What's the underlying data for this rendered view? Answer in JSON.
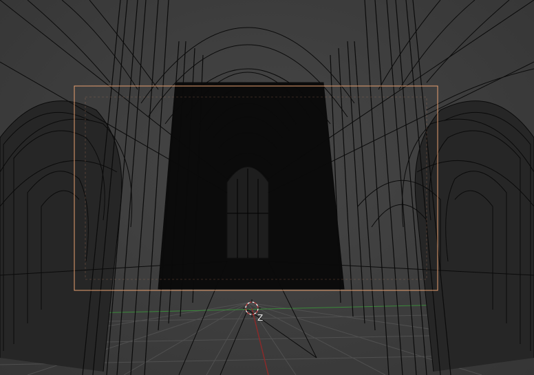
{
  "viewport": {
    "mode": "wireframe",
    "scene": "gothic-cathedral-nave",
    "background_color": "#3d3d3d",
    "wire_color": "#0a0a0a",
    "camera_frame_color": "#e8a070",
    "grid_color": "#5a5a5a",
    "x_axis_color": "#3a8a3a",
    "y_axis_color": "#8a2a2a",
    "cursor_color": "#ffffff",
    "cursor_accent_color": "#d04040",
    "axis_gizmo_label": "Z"
  }
}
